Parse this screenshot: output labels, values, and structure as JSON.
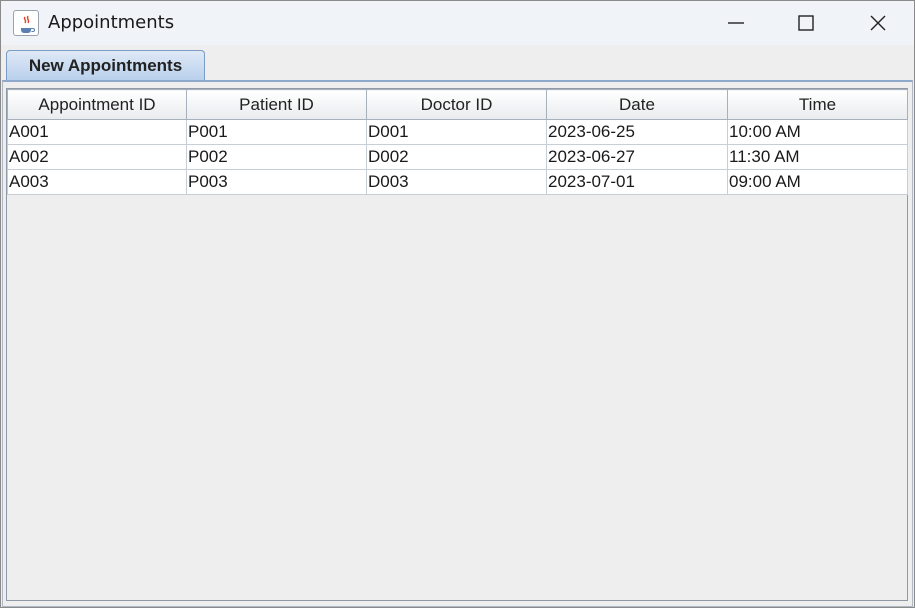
{
  "window": {
    "title": "Appointments",
    "icon": "java-coffee-icon"
  },
  "tabs": [
    {
      "label": "New Appointments",
      "selected": true
    }
  ],
  "table": {
    "columns": [
      "Appointment ID",
      "Patient ID",
      "Doctor ID",
      "Date",
      "Time"
    ],
    "rows": [
      [
        "A001",
        "P001",
        "D001",
        "2023-06-25",
        "10:00 AM"
      ],
      [
        "A002",
        "P002",
        "D002",
        "2023-06-27",
        "11:30 AM"
      ],
      [
        "A003",
        "P003",
        "D003",
        "2023-07-01",
        "09:00 AM"
      ]
    ]
  }
}
